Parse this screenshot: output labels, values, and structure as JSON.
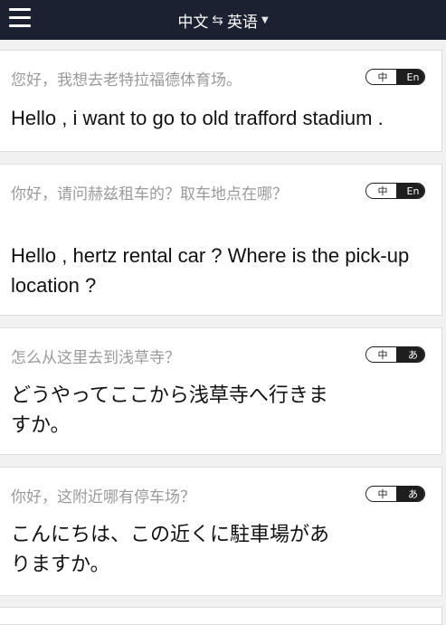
{
  "header": {
    "source_lang": "中文",
    "swap_symbol": "⇆",
    "target_lang": "英语",
    "caret": "▼"
  },
  "cards": [
    {
      "source": "您好，我想去老特拉福德体育场。",
      "translation": "Hello , i want to go to old trafford stadium .",
      "badge_from": "中",
      "badge_to": "En"
    },
    {
      "source": "你好，请问赫兹租车的？取车地点在哪？",
      "translation": "Hello , hertz rental car ? Where is the pick-up location ?",
      "badge_from": "中",
      "badge_to": "En"
    },
    {
      "source": "怎么从这里去到浅草寺？",
      "translation": "どうやってここから浅草寺へ行きますか。",
      "badge_from": "中",
      "badge_to": "あ"
    },
    {
      "source": "你好，这附近哪有停车场？",
      "translation": "こんにちは、この近くに駐車場がありますか。",
      "badge_from": "中",
      "badge_to": "あ"
    }
  ]
}
